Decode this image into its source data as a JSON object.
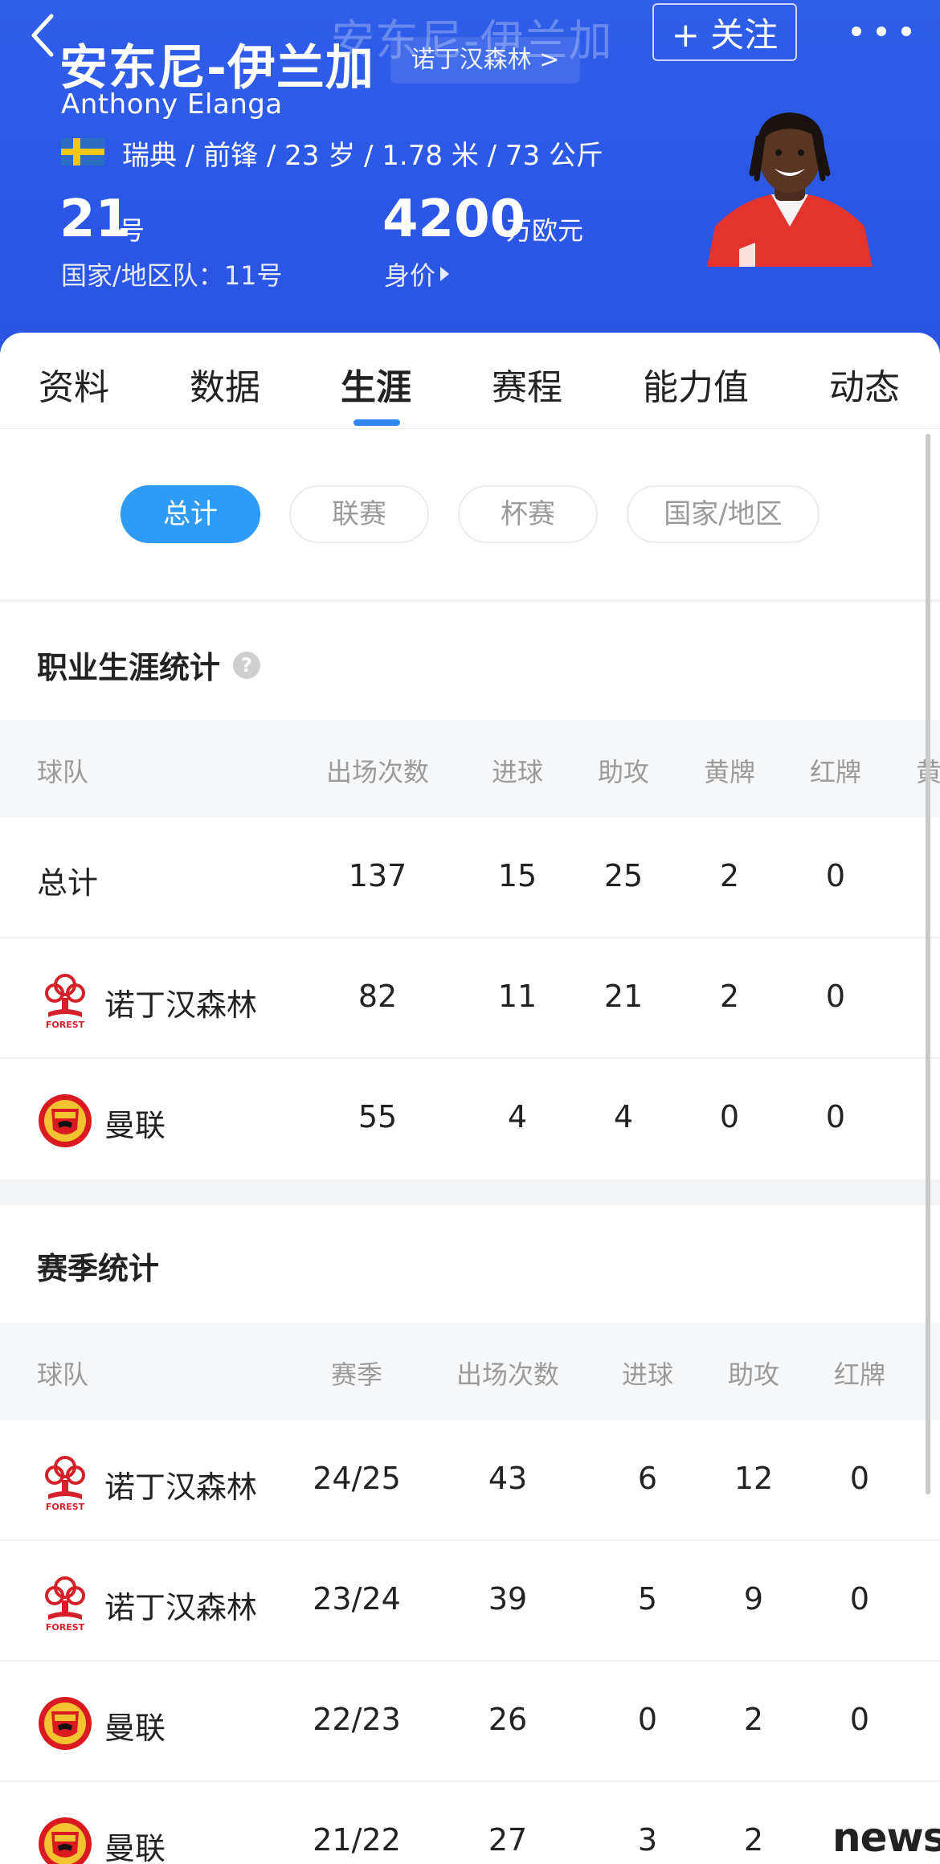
{
  "header": {
    "ghost_title": "安东尼-伊兰加",
    "name_cn": "安东尼-伊兰加",
    "club_link": "诺丁汉森林 >",
    "follow": "+ 关注",
    "name_en": "Anthony Elanga",
    "meta": "瑞典 / 前锋 / 23 岁 / 1.78 米 / 73 公斤",
    "shirt_number": "21",
    "shirt_number_unit": "号",
    "national_team_number": "国家/地区队：11号",
    "market_value": "4200",
    "market_value_unit": "万欧元",
    "market_value_label": "身价",
    "icons": {
      "back": "chevron-left-icon",
      "more": "more-dots-icon",
      "flag": "sweden-flag"
    }
  },
  "tabs": [
    {
      "label": "资料",
      "active": false
    },
    {
      "label": "数据",
      "active": false
    },
    {
      "label": "生涯",
      "active": true
    },
    {
      "label": "赛程",
      "active": false
    },
    {
      "label": "能力值",
      "active": false
    },
    {
      "label": "动态",
      "active": false
    }
  ],
  "filters": [
    {
      "label": "总计",
      "active": true
    },
    {
      "label": "联赛",
      "active": false
    },
    {
      "label": "杯赛",
      "active": false
    },
    {
      "label": "国家/地区",
      "active": false
    }
  ],
  "career": {
    "title": "职业生涯统计",
    "help": "?",
    "columns": [
      "球队",
      "出场次数",
      "进球",
      "助攻",
      "黄牌",
      "红牌",
      "黄"
    ],
    "rows": [
      {
        "team": "总计",
        "logo": "",
        "apps": "137",
        "goals": "15",
        "assists": "25",
        "yellow": "2",
        "red": "0"
      },
      {
        "team": "诺丁汉森林",
        "logo": "forest",
        "apps": "82",
        "goals": "11",
        "assists": "21",
        "yellow": "2",
        "red": "0"
      },
      {
        "team": "曼联",
        "logo": "manutd",
        "apps": "55",
        "goals": "4",
        "assists": "4",
        "yellow": "0",
        "red": "0"
      }
    ]
  },
  "season": {
    "title": "赛季统计",
    "columns": [
      "球队",
      "赛季",
      "出场次数",
      "进球",
      "助攻",
      "红牌"
    ],
    "rows": [
      {
        "team": "诺丁汉森林",
        "logo": "forest",
        "season": "24/25",
        "apps": "43",
        "goals": "6",
        "assists": "12",
        "red": "0"
      },
      {
        "team": "诺丁汉森林",
        "logo": "forest",
        "season": "23/24",
        "apps": "39",
        "goals": "5",
        "assists": "9",
        "red": "0"
      },
      {
        "team": "曼联",
        "logo": "manutd",
        "season": "22/23",
        "apps": "26",
        "goals": "0",
        "assists": "2",
        "red": "0"
      },
      {
        "team": "曼联",
        "logo": "manutd",
        "season": "21/22",
        "apps": "27",
        "goals": "3",
        "assists": "2",
        "red": ""
      }
    ]
  },
  "watermark": "news",
  "colors": {
    "header_blue": "#2c57e6",
    "accent": "#2f9bf5",
    "tab_indicator": "#2f86f5",
    "forest_red": "#d5202a",
    "manutd_red": "#da1a20",
    "manutd_gold": "#f2c230"
  }
}
